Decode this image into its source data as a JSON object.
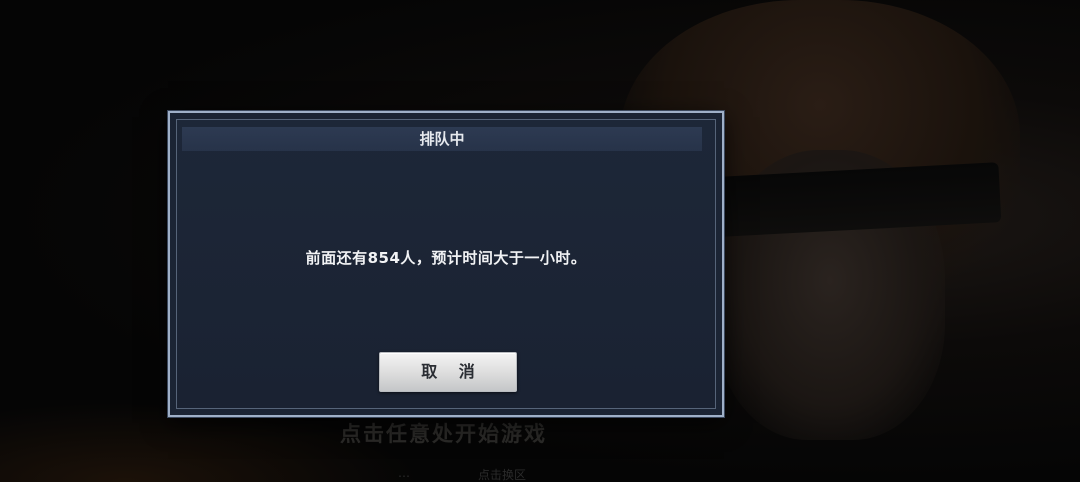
{
  "background": {
    "start_prompt": "点击任意处开始游戏",
    "bottom_link_1": "…",
    "bottom_link_2": "点击换区"
  },
  "dialog": {
    "title": "排队中",
    "message": "前面还有854人，预计时间大于一小时。",
    "cancel_label": "取 消",
    "queue_ahead_count": 854
  },
  "colors": {
    "dialog_bg": "#1b2434",
    "dialog_border": "#9fb0c8",
    "titlebar_bg": "#2d3a52",
    "button_bg": "#dcdcdc"
  }
}
